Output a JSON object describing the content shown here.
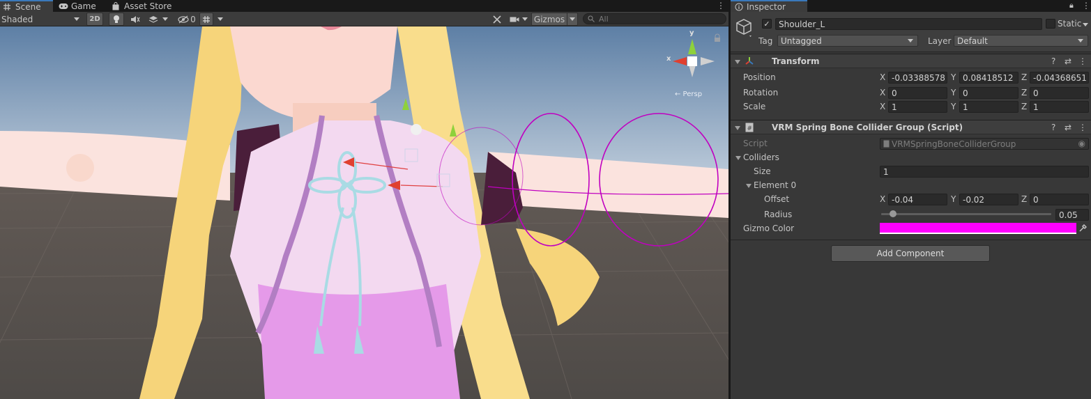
{
  "tabs": {
    "scene": "Scene",
    "game": "Game",
    "asset_store": "Asset Store",
    "inspector": "Inspector"
  },
  "scene_toolbar": {
    "shading_mode": "Shaded",
    "mode_2d": "2D",
    "hidden_count": "0",
    "gizmos": "Gizmos",
    "search_placeholder": "All"
  },
  "viewport": {
    "axis_y": "y",
    "axis_x": "x",
    "persp_label": "← Persp"
  },
  "inspector": {
    "object_name": "Shoulder_L",
    "active": true,
    "static_label": "Static",
    "tag_label": "Tag",
    "tag_value": "Untagged",
    "layer_label": "Layer",
    "layer_value": "Default",
    "transform": {
      "title": "Transform",
      "position_label": "Position",
      "rotation_label": "Rotation",
      "scale_label": "Scale",
      "position": {
        "x": "-0.03388578",
        "y": "0.08418512",
        "z": "-0.04368651"
      },
      "rotation": {
        "x": "0",
        "y": "0",
        "z": "0"
      },
      "scale": {
        "x": "1",
        "y": "1",
        "z": "1"
      }
    },
    "collider_group": {
      "title": "VRM Spring Bone Collider Group (Script)",
      "script_label": "Script",
      "script_value": "VRMSpringBoneColliderGroup",
      "colliders_label": "Colliders",
      "size_label": "Size",
      "size_value": "1",
      "element_label": "Element 0",
      "offset_label": "Offset",
      "offset": {
        "x": "-0.04",
        "y": "-0.02",
        "z": "0"
      },
      "radius_label": "Radius",
      "radius_value": "0.05",
      "radius_fraction": 0.05,
      "gizmo_color_label": "Gizmo Color",
      "gizmo_color": "#ff00ff"
    },
    "add_component": "Add Component"
  },
  "axis_letters": {
    "x": "X",
    "y": "Y",
    "z": "Z"
  },
  "colors": {
    "accent": "#3a79bb",
    "panel": "#383838",
    "gizmo_magenta": "#ff00ff"
  }
}
